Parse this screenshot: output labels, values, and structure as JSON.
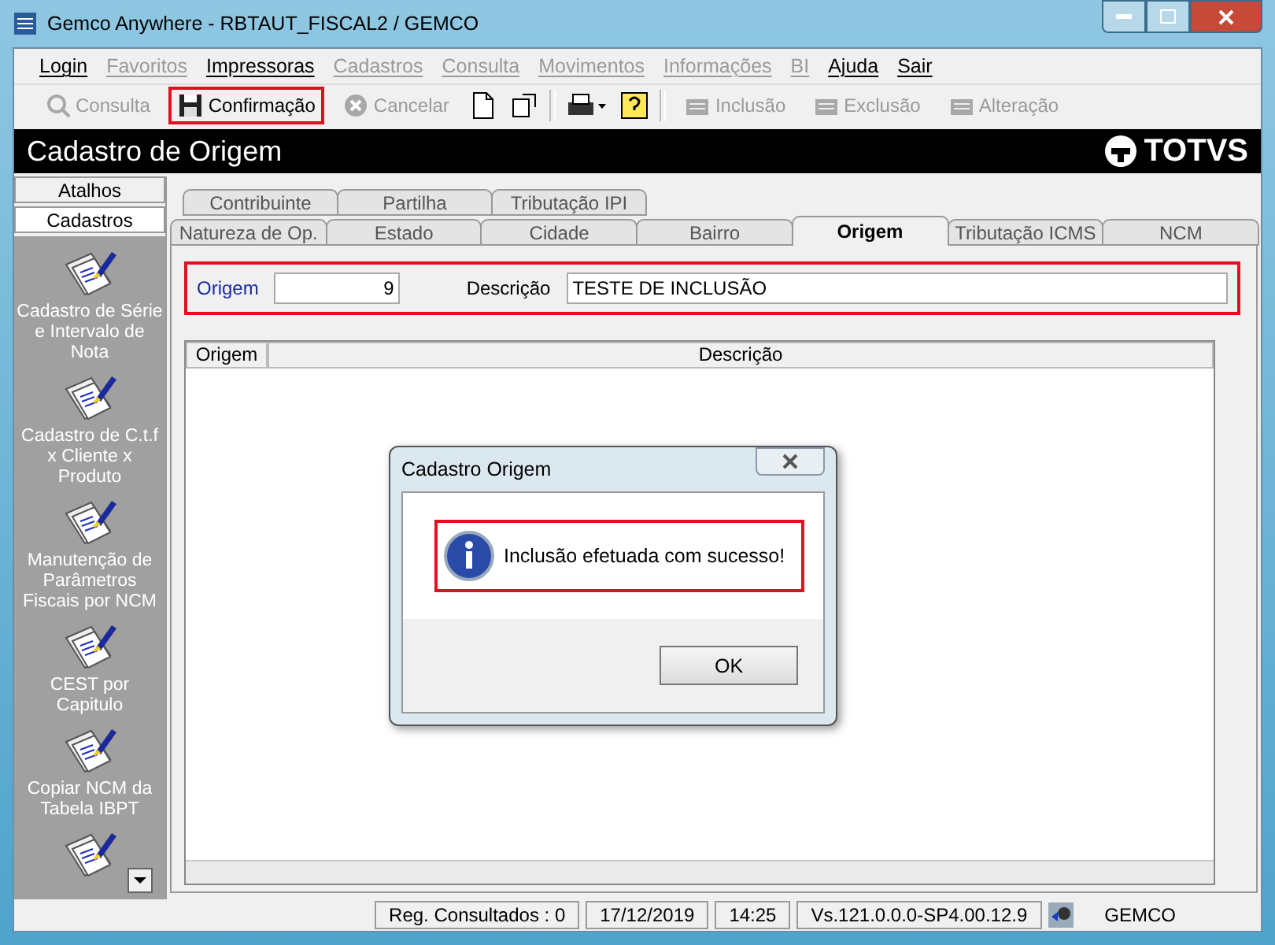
{
  "window": {
    "title": "Gemco Anywhere - RBTAUT_FISCAL2 / GEMCO"
  },
  "menu": [
    {
      "label": "Login",
      "disabled": false
    },
    {
      "label": "Favoritos",
      "disabled": true
    },
    {
      "label": "Impressoras",
      "disabled": false
    },
    {
      "label": "Cadastros",
      "disabled": true
    },
    {
      "label": "Consulta",
      "disabled": true
    },
    {
      "label": "Movimentos",
      "disabled": true
    },
    {
      "label": "Informações",
      "disabled": true
    },
    {
      "label": "BI",
      "disabled": true
    },
    {
      "label": "Ajuda",
      "disabled": false
    },
    {
      "label": "Sair",
      "disabled": false
    }
  ],
  "toolbar": [
    {
      "kind": "text",
      "label": "Consulta",
      "disabled": true,
      "highlighted": false
    },
    {
      "kind": "text",
      "label": "Confirmação",
      "disabled": false,
      "highlighted": true
    },
    {
      "kind": "text",
      "label": "Cancelar",
      "disabled": true,
      "highlighted": false
    },
    {
      "kind": "icons"
    },
    {
      "kind": "text",
      "label": "Inclusão",
      "disabled": true,
      "highlighted": false
    },
    {
      "kind": "text",
      "label": "Exclusão",
      "disabled": true,
      "highlighted": false
    },
    {
      "kind": "text",
      "label": "Alteração",
      "disabled": true,
      "highlighted": false
    }
  ],
  "header": {
    "title": "Cadastro de Origem",
    "logo": "TOTVS"
  },
  "sidebar": {
    "groups": [
      {
        "label": "Atalhos",
        "selected": false
      },
      {
        "label": "Cadastros",
        "selected": true
      }
    ],
    "items": [
      {
        "label": "Cadastro de Série e Intervalo de Nota"
      },
      {
        "label": "Cadastro de C.t.f x Cliente x Produto"
      },
      {
        "label": "Manutenção de Parâmetros Fiscais por NCM"
      },
      {
        "label": "CEST por Capitulo"
      },
      {
        "label": "Copiar NCM da Tabela IBPT"
      }
    ]
  },
  "tabs": {
    "row_1": [
      {
        "label": "Contribuinte",
        "selected": false
      },
      {
        "label": "Partilha",
        "selected": false
      },
      {
        "label": "Tributação IPI",
        "selected": false
      }
    ],
    "row_2": [
      {
        "label": "Natureza de Op.",
        "selected": false
      },
      {
        "label": "Estado",
        "selected": false
      },
      {
        "label": "Cidade",
        "selected": false
      },
      {
        "label": "Bairro",
        "selected": false
      },
      {
        "label": "Origem",
        "selected": true
      },
      {
        "label": "Tributação ICMS",
        "selected": false
      },
      {
        "label": "NCM",
        "selected": false
      }
    ]
  },
  "form": {
    "highlighted": true,
    "origem_label": "Origem",
    "origem_value": "9",
    "descricao_label": "Descrição",
    "descricao_value": "TESTE DE INCLUSÃO"
  },
  "table": {
    "columns": [
      "Origem",
      "Descrição"
    ]
  },
  "dialog": {
    "title": "Cadastro Origem",
    "message": "Inclusão efetuada com sucesso!",
    "highlighted": true,
    "button": "OK"
  },
  "status_bar": [
    "Reg. Consultados : 0",
    "17/12/2019",
    "14:25",
    "Vs.121.0.0.0-SP4.00.12.9",
    "GEMCO"
  ]
}
